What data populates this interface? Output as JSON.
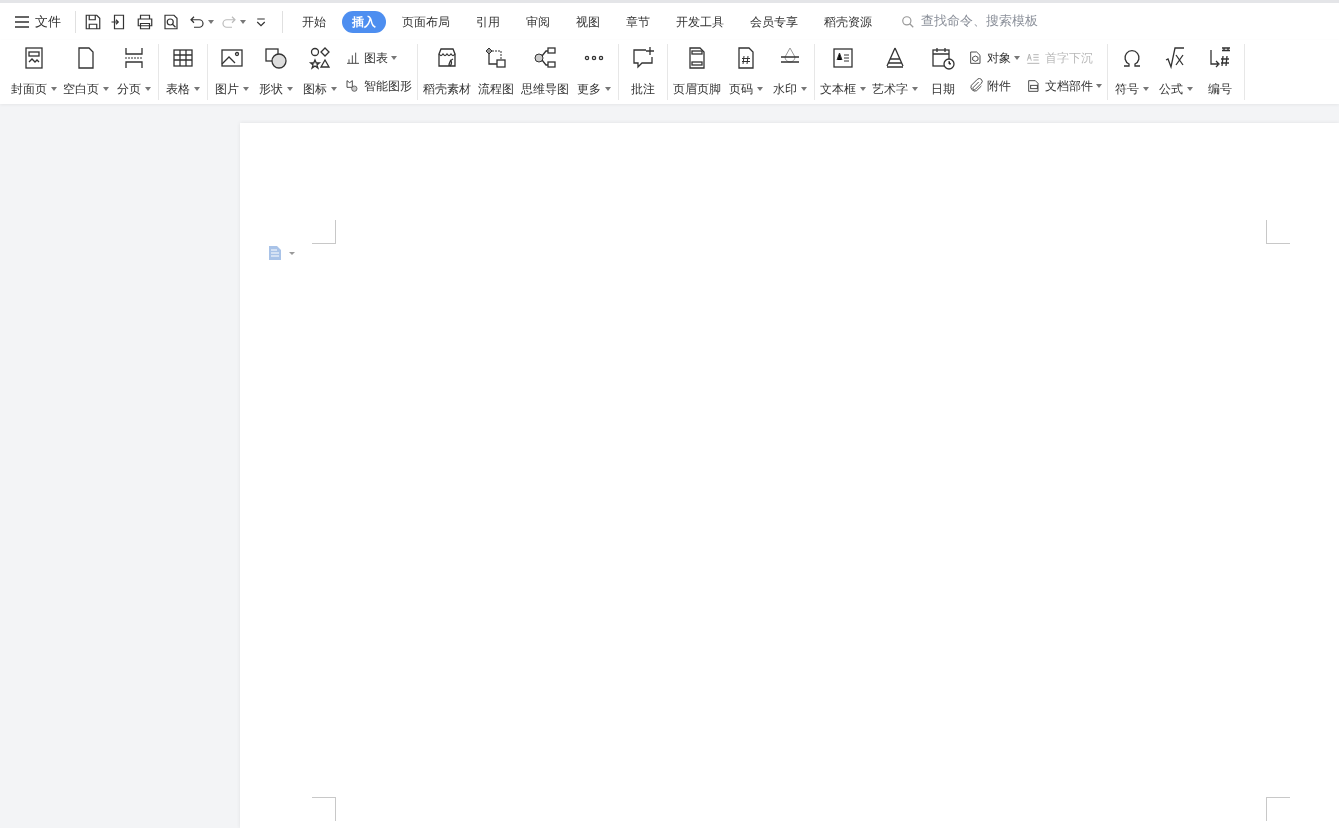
{
  "menu": {
    "label": "文件"
  },
  "tabs": [
    {
      "label": "开始",
      "selected": false
    },
    {
      "label": "插入",
      "selected": true
    },
    {
      "label": "页面布局",
      "selected": false
    },
    {
      "label": "引用",
      "selected": false
    },
    {
      "label": "审阅",
      "selected": false
    },
    {
      "label": "视图",
      "selected": false
    },
    {
      "label": "章节",
      "selected": false
    },
    {
      "label": "开发工具",
      "selected": false
    },
    {
      "label": "会员专享",
      "selected": false
    },
    {
      "label": "稻壳资源",
      "selected": false
    }
  ],
  "search": {
    "placeholder": "查找命令、搜索模板"
  },
  "ribbon_groups": [
    {
      "items": [
        {
          "kind": "big",
          "label": "封面页",
          "dropdown": true
        },
        {
          "kind": "big",
          "label": "空白页",
          "dropdown": true
        },
        {
          "kind": "big",
          "label": "分页",
          "dropdown": true
        }
      ]
    },
    {
      "items": [
        {
          "kind": "big",
          "label": "表格",
          "dropdown": true
        }
      ]
    },
    {
      "items": [
        {
          "kind": "big",
          "label": "图片",
          "dropdown": true
        },
        {
          "kind": "big",
          "label": "形状",
          "dropdown": true
        },
        {
          "kind": "big",
          "label": "图标",
          "dropdown": true
        },
        {
          "kind": "stack",
          "children": [
            {
              "label": "图表",
              "dropdown": true,
              "disabled": false
            },
            {
              "label": "智能图形",
              "dropdown": false,
              "disabled": false
            }
          ]
        }
      ]
    },
    {
      "items": [
        {
          "kind": "big",
          "label": "稻壳素材",
          "dropdown": false
        },
        {
          "kind": "big",
          "label": "流程图",
          "dropdown": false
        },
        {
          "kind": "big",
          "label": "思维导图",
          "dropdown": false
        },
        {
          "kind": "big",
          "label": "更多",
          "dropdown": true
        }
      ]
    },
    {
      "items": [
        {
          "kind": "big",
          "label": "批注",
          "dropdown": false
        }
      ]
    },
    {
      "items": [
        {
          "kind": "big",
          "label": "页眉页脚",
          "dropdown": false
        },
        {
          "kind": "big",
          "label": "页码",
          "dropdown": true
        },
        {
          "kind": "big",
          "label": "水印",
          "dropdown": true
        }
      ]
    },
    {
      "items": [
        {
          "kind": "big",
          "label": "文本框",
          "dropdown": true
        },
        {
          "kind": "big",
          "label": "艺术字",
          "dropdown": true
        },
        {
          "kind": "big",
          "label": "日期",
          "dropdown": false
        },
        {
          "kind": "stack",
          "children": [
            {
              "label": "对象",
              "dropdown": true,
              "disabled": false
            },
            {
              "label": "附件",
              "dropdown": false,
              "disabled": false
            }
          ]
        },
        {
          "kind": "stack",
          "children": [
            {
              "label": "首字下沉",
              "dropdown": false,
              "disabled": true
            },
            {
              "label": "文档部件",
              "dropdown": true,
              "disabled": false
            }
          ]
        }
      ]
    },
    {
      "items": [
        {
          "kind": "big",
          "label": "符号",
          "dropdown": true
        },
        {
          "kind": "big",
          "label": "公式",
          "dropdown": true
        },
        {
          "kind": "big",
          "label": "编号",
          "dropdown": false
        }
      ]
    }
  ]
}
